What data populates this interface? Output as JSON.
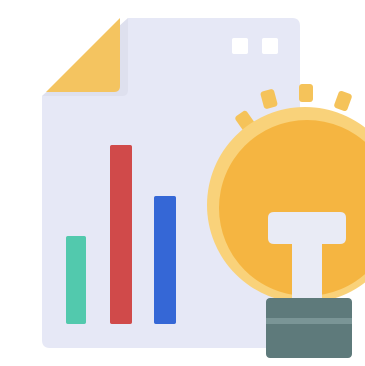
{
  "image": {
    "type": "icon-illustration",
    "subject": "report-document-with-bar-chart-and-lightbulb",
    "icons": [
      "document-icon",
      "bar-chart-icon",
      "lightbulb-icon"
    ]
  },
  "colors": {
    "background": "#ffffff",
    "document_page": "#e6e8f6",
    "document_fold": "#f4c460",
    "document_fold_shadow": "#d9dbe9",
    "header_dots": "#ffffff",
    "bar_1": "#52c9ad",
    "bar_2": "#d04a4a",
    "bar_3": "#3567d6",
    "bulb_glass": "#f5b541",
    "bulb_glow_ring": "#f9d27a",
    "bulb_rays": "#f5c35a",
    "bulb_filament": "#e9ebf5",
    "bulb_base": "#5e7a7b",
    "bulb_base_stripe": "#7a9596"
  },
  "chart": {
    "bar_levels": [
      0.42,
      0.85,
      0.61
    ]
  }
}
